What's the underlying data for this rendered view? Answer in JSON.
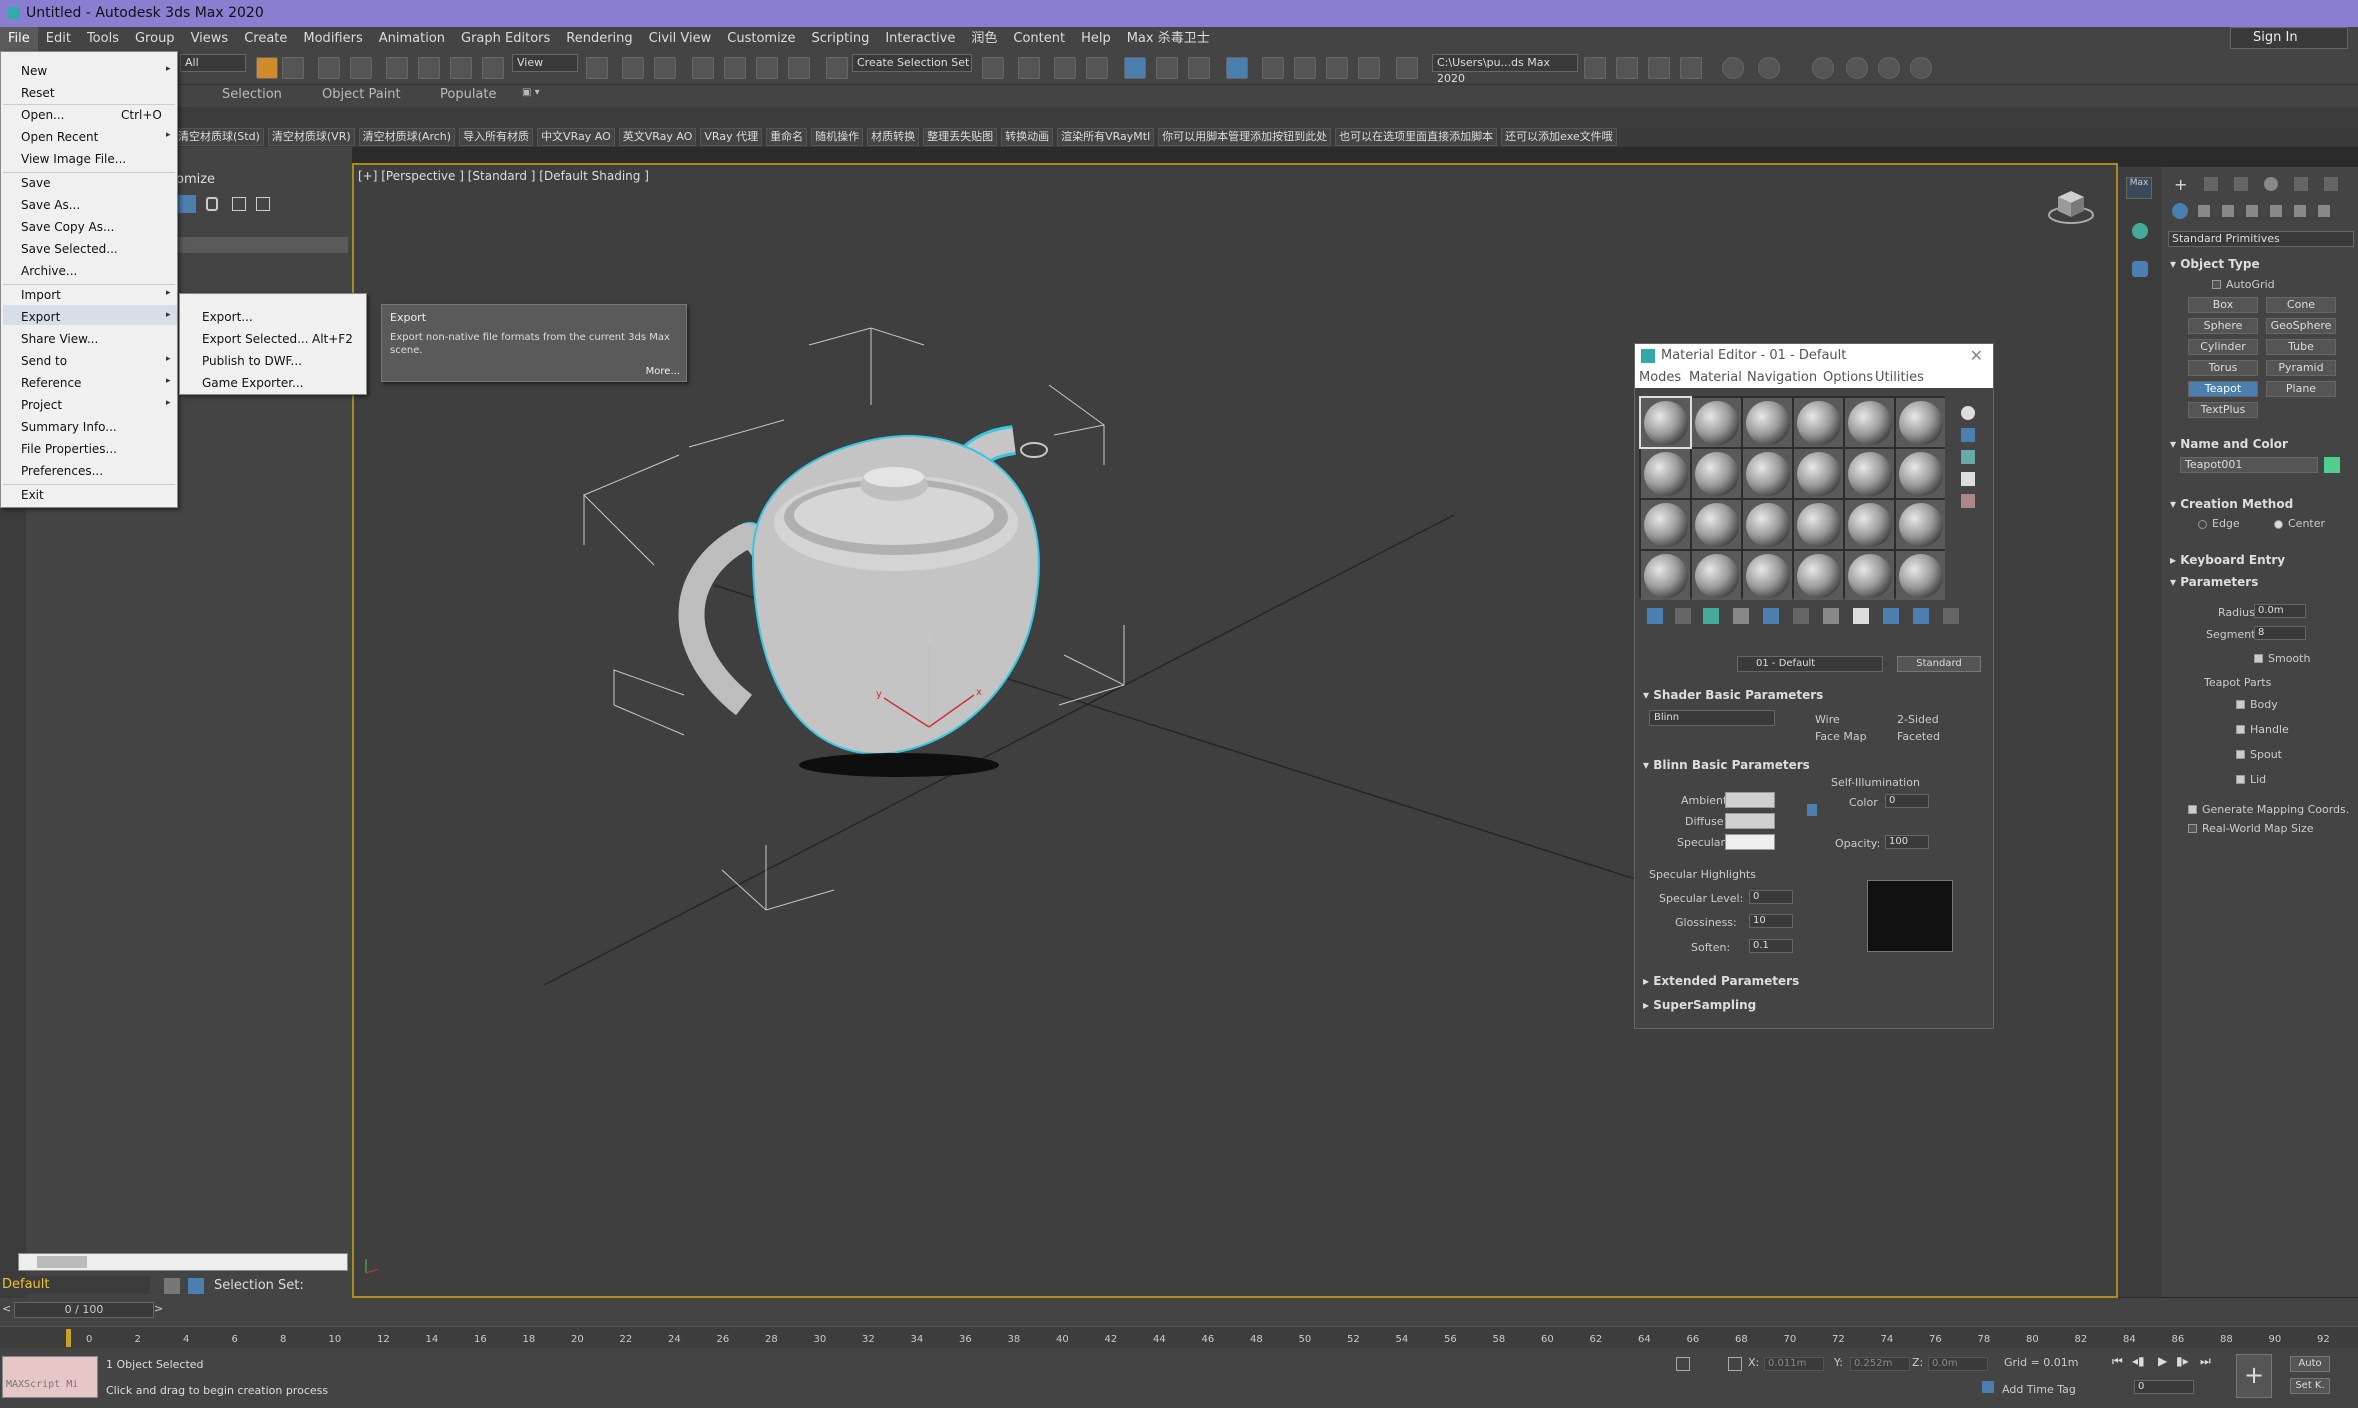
{
  "window": {
    "title": "Untitled - Autodesk 3ds Max 2020"
  },
  "menubar": {
    "items": [
      "File",
      "Edit",
      "Tools",
      "Group",
      "Views",
      "Create",
      "Modifiers",
      "Animation",
      "Graph Editors",
      "Rendering",
      "Civil View",
      "Customize",
      "Scripting",
      "Interactive",
      "润色",
      "Content",
      "Help",
      "Max 杀毒卫士"
    ],
    "sign_in": "Sign In"
  },
  "toolbar": {
    "filter": "All",
    "ref_coord": "View",
    "named_selection": "Create Selection Set",
    "project_path": "C:\\Users\\pu...ds Max 2020"
  },
  "ribbon_tabs": [
    "Selection",
    "Object Paint",
    "Populate"
  ],
  "custom_bar": [
    "清空材质球(Std)",
    "清空材质球(VR)",
    "清空材质球(Arch)",
    "导入所有材质",
    "中文VRay AO",
    "英文VRay AO",
    "VRay 代理",
    "重命名",
    "随机操作",
    "材质转换",
    "整理丢失贴图",
    "转换动画",
    "渲染所有VRayMtl",
    "你可以用脚本管理添加按钮到此处",
    "也可以在选项里面直接添加脚本",
    "还可以添加exe文件哦"
  ],
  "scene_explorer": {
    "header": "omize"
  },
  "viewport": {
    "label": "[+] [Perspective ] [Standard ] [Default Shading ]",
    "axis_z": "z",
    "axis_x": "x",
    "axis_y": "y"
  },
  "file_menu": {
    "items": [
      {
        "label": "New",
        "shortcut": "",
        "submenu": true
      },
      {
        "label": "Reset",
        "shortcut": "",
        "submenu": false
      },
      {
        "label": "Open...",
        "shortcut": "Ctrl+O",
        "submenu": false
      },
      {
        "label": "Open Recent",
        "shortcut": "",
        "submenu": true
      },
      {
        "label": "View Image File...",
        "shortcut": "",
        "submenu": false
      },
      {
        "label": "Save",
        "shortcut": "",
        "submenu": false
      },
      {
        "label": "Save As...",
        "shortcut": "",
        "submenu": false
      },
      {
        "label": "Save Copy As...",
        "shortcut": "",
        "submenu": false
      },
      {
        "label": "Save Selected...",
        "shortcut": "",
        "submenu": false
      },
      {
        "label": "Archive...",
        "shortcut": "",
        "submenu": false
      },
      {
        "label": "Import",
        "shortcut": "",
        "submenu": true
      },
      {
        "label": "Export",
        "shortcut": "",
        "submenu": true
      },
      {
        "label": "Share View...",
        "shortcut": "",
        "submenu": false
      },
      {
        "label": "Send to",
        "shortcut": "",
        "submenu": true
      },
      {
        "label": "Reference",
        "shortcut": "",
        "submenu": true
      },
      {
        "label": "Project",
        "shortcut": "",
        "submenu": true
      },
      {
        "label": "Summary Info...",
        "shortcut": "",
        "submenu": false
      },
      {
        "label": "File Properties...",
        "shortcut": "",
        "submenu": false
      },
      {
        "label": "Preferences...",
        "shortcut": "",
        "submenu": false
      },
      {
        "label": "Exit",
        "shortcut": "",
        "submenu": false
      }
    ]
  },
  "export_submenu": {
    "items": [
      {
        "label": "Export...",
        "shortcut": ""
      },
      {
        "label": "Export Selected...",
        "shortcut": "Alt+F2"
      },
      {
        "label": "Publish to DWF...",
        "shortcut": ""
      },
      {
        "label": "Game Exporter...",
        "shortcut": ""
      }
    ]
  },
  "tooltip": {
    "title": "Export",
    "body": "Export non-native file formats from the current 3ds Max scene.",
    "more": "More..."
  },
  "material_editor": {
    "title": "Material Editor - 01 - Default",
    "menu": [
      "Modes",
      "Material",
      "Navigation",
      "Options",
      "Utilities"
    ],
    "material_name": "01 - Default",
    "material_type": "Standard",
    "shader_rollout": "Shader Basic Parameters",
    "shader": "Blinn",
    "wire": "Wire",
    "two_sided": "2-Sided",
    "face_map": "Face Map",
    "faceted": "Faceted",
    "blinn_rollout": "Blinn Basic Parameters",
    "self_illum": "Self-Illumination",
    "ambient": "Ambient:",
    "diffuse": "Diffuse:",
    "specular": "Specular:",
    "color_label": "Color",
    "color_value": "0",
    "opacity_label": "Opacity:",
    "opacity_value": "100",
    "spec_highlights": "Specular Highlights",
    "spec_level_label": "Specular Level:",
    "spec_level": "0",
    "gloss_label": "Glossiness:",
    "gloss": "10",
    "soften_label": "Soften:",
    "soften": "0.1",
    "extended": "Extended Parameters",
    "supersampling": "SuperSampling"
  },
  "command_panel": {
    "category": "Standard Primitives",
    "object_type": "Object Type",
    "autogrid": "AutoGrid",
    "buttons": [
      "Box",
      "Cone",
      "Sphere",
      "GeoSphere",
      "Cylinder",
      "Tube",
      "Torus",
      "Pyramid",
      "Teapot",
      "Plane",
      "TextPlus"
    ],
    "name_color": "Name and Color",
    "object_name": "Teapot001",
    "object_color": "#4fcf8f",
    "creation_method": "Creation Method",
    "edge": "Edge",
    "center": "Center",
    "keyboard_entry": "Keyboard Entry",
    "parameters": "Parameters",
    "radius_label": "Radius:",
    "radius": "0.0m",
    "segments_label": "Segments:",
    "segments": "8",
    "smooth": "Smooth",
    "teapot_parts": "Teapot Parts",
    "body": "Body",
    "handle": "Handle",
    "spout": "Spout",
    "lid": "Lid",
    "gen_mapping": "Generate Mapping Coords.",
    "real_world": "Real-World Map Size"
  },
  "status": {
    "layer": "Default",
    "selection_set": "Selection Set:",
    "frames": "0 / 100",
    "maxscript": "MAXScript Mi",
    "selected": "1 Object Selected",
    "prompt": "Click and drag to begin creation process",
    "x_label": "X:",
    "x": "0.011m",
    "y_label": "Y:",
    "y": "0.252m",
    "z_label": "Z:",
    "z": "0.0m",
    "grid": "Grid = 0.01m",
    "add_time_tag": "Add Time Tag",
    "auto": "Auto",
    "set_key": "Set K.",
    "frame_field": "0"
  },
  "timeline_ticks": [
    "0",
    "2",
    "4",
    "6",
    "8",
    "10",
    "12",
    "14",
    "16",
    "18",
    "20",
    "22",
    "24",
    "26",
    "28",
    "30",
    "32",
    "34",
    "36",
    "38",
    "40",
    "42",
    "44",
    "46",
    "48",
    "50",
    "52",
    "54",
    "56",
    "58",
    "60",
    "62",
    "64",
    "66",
    "68",
    "70",
    "72",
    "74",
    "76",
    "78",
    "80",
    "82",
    "84",
    "86",
    "88",
    "90",
    "92"
  ],
  "colors": {
    "titlebar": "#8a7ed0",
    "viewport_border": "#a88c1e",
    "selection_outline": "#39c6e0",
    "layer_text": "#e8c33a",
    "active_button": "#4a7fb0"
  }
}
